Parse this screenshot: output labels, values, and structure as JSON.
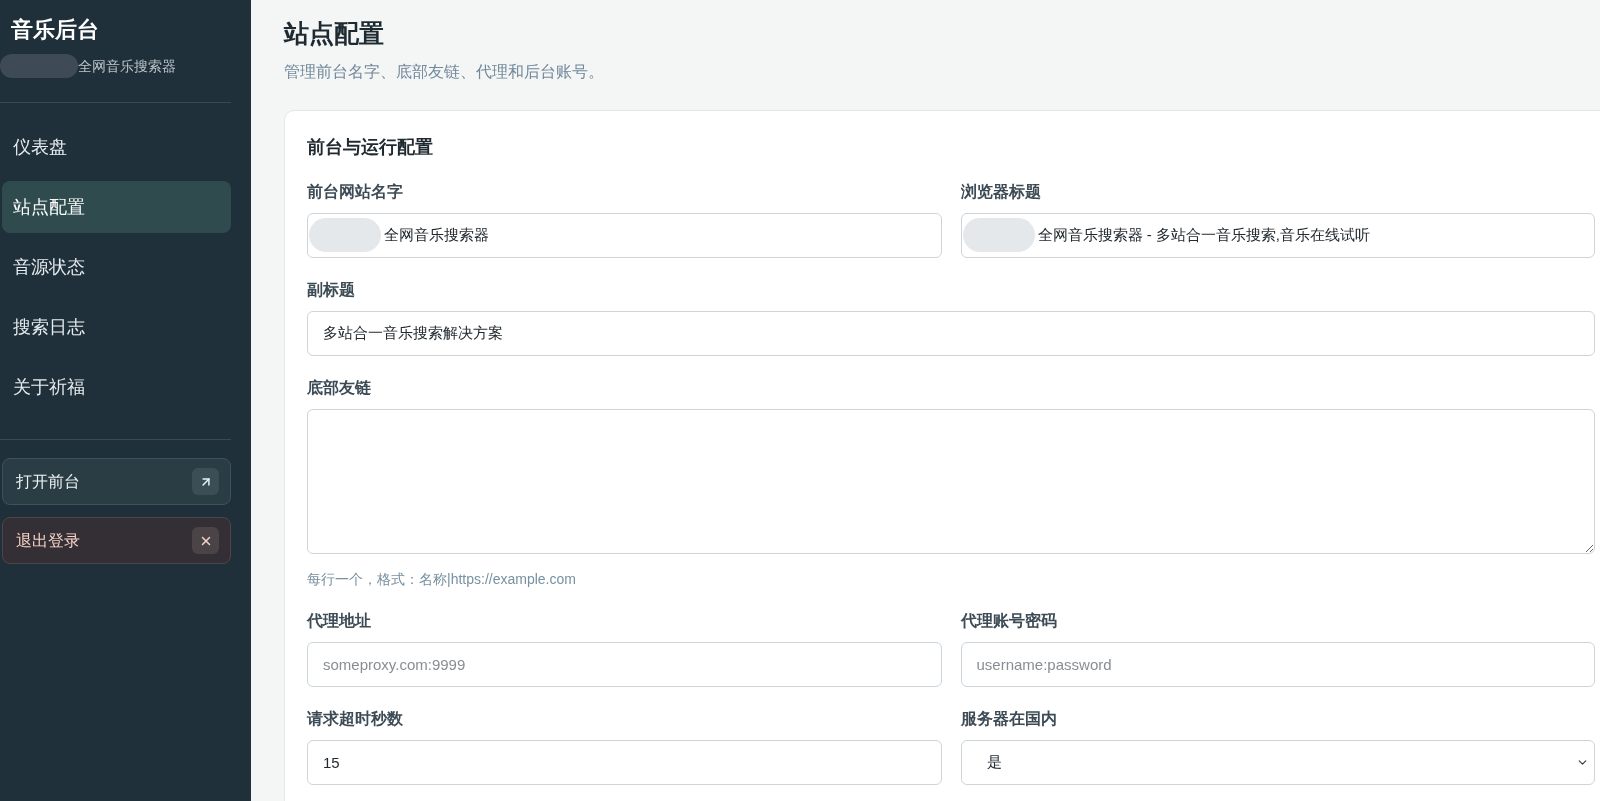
{
  "sidebar": {
    "title": "音乐后台",
    "subtitle": {
      "text": "全网音乐搜索器",
      "redacted": true
    },
    "nav": [
      {
        "label": "仪表盘",
        "selected": false
      },
      {
        "label": "站点配置",
        "selected": true
      },
      {
        "label": "音源状态",
        "selected": false
      },
      {
        "label": "搜索日志",
        "selected": false
      },
      {
        "label": "关于祈福",
        "selected": false
      }
    ],
    "actions": [
      {
        "kind": "open",
        "label": "打开前台"
      },
      {
        "kind": "logout",
        "label": "退出登录"
      }
    ]
  },
  "page": {
    "title": "站点配置",
    "description": "管理前台名字、底部友链、代理和后台账号。"
  },
  "card": {
    "title": "前台与运行配置",
    "rows": [
      [
        {
          "kind": "text",
          "label": "前台网站名字",
          "value": "全网音乐搜索器",
          "redacted": true
        },
        {
          "kind": "text",
          "label": "浏览器标题",
          "value": "全网音乐搜索器 - 多站合一音乐搜索,音乐在线试听",
          "redacted": true
        }
      ],
      [
        {
          "kind": "text",
          "label": "副标题",
          "value": "多站合一音乐搜索解决方案",
          "redacted": false
        }
      ],
      [
        {
          "kind": "textarea",
          "label": "底部友链",
          "hint": "每行一个，格式：名称|https://example.com"
        }
      ],
      [
        {
          "kind": "text",
          "label": "代理地址",
          "placeholder": "someproxy.com:9999",
          "redacted": false
        },
        {
          "kind": "text",
          "label": "代理账号密码",
          "placeholder": "username:password",
          "redacted": false
        }
      ],
      [
        {
          "kind": "text",
          "label": "请求超时秒数",
          "value": "15",
          "redacted": false
        },
        {
          "kind": "select",
          "label": "服务器在国内",
          "value": "是"
        }
      ]
    ]
  }
}
